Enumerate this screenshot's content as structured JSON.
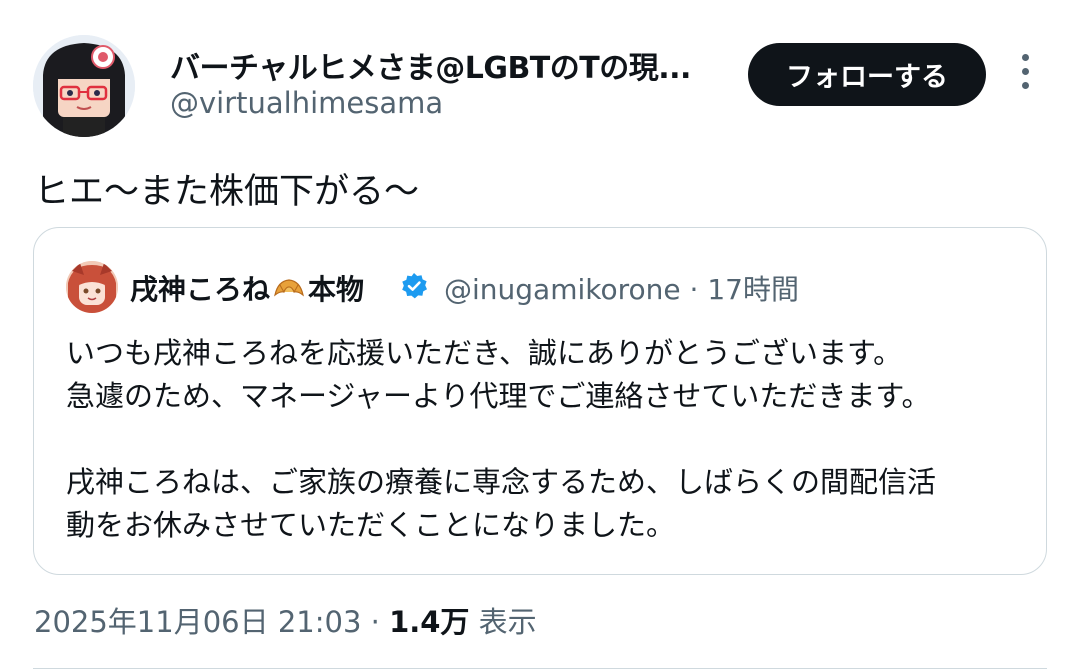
{
  "author": {
    "display_name": "バーチャルヒメさま@LGBTのTの現...",
    "handle": "@virtualhimesama"
  },
  "follow_button": {
    "label": "フォローする"
  },
  "tweet": {
    "text": "ヒエ〜また株価下がる〜"
  },
  "quoted_tweet": {
    "display_name_pre": "戌神ころね",
    "display_name_post": "本物",
    "display_name_icon": "croissant-icon",
    "verified": true,
    "handle": "@inugamikorone",
    "separator": "·",
    "time": "17時間",
    "body_lines": [
      "いつも戌神ころねを応援いただき、誠にありがとうございます。",
      "急遽のため、マネージャーより代理でご連絡させていただきます。",
      "戌神ころねは、ご家族の療養に専念するため、しばらくの間配信活",
      "動をお休みさせていただくことになりました。"
    ]
  },
  "meta": {
    "timestamp": "2025年11月06日 21:03",
    "separator": "·",
    "views_count": "1.4万",
    "views_label": "表示"
  },
  "colors": {
    "text": "#0f1419",
    "secondary_text": "#536471",
    "border": "#cfd9de",
    "follow_bg": "#0f1419",
    "verified_blue": "#1d9bf0"
  }
}
